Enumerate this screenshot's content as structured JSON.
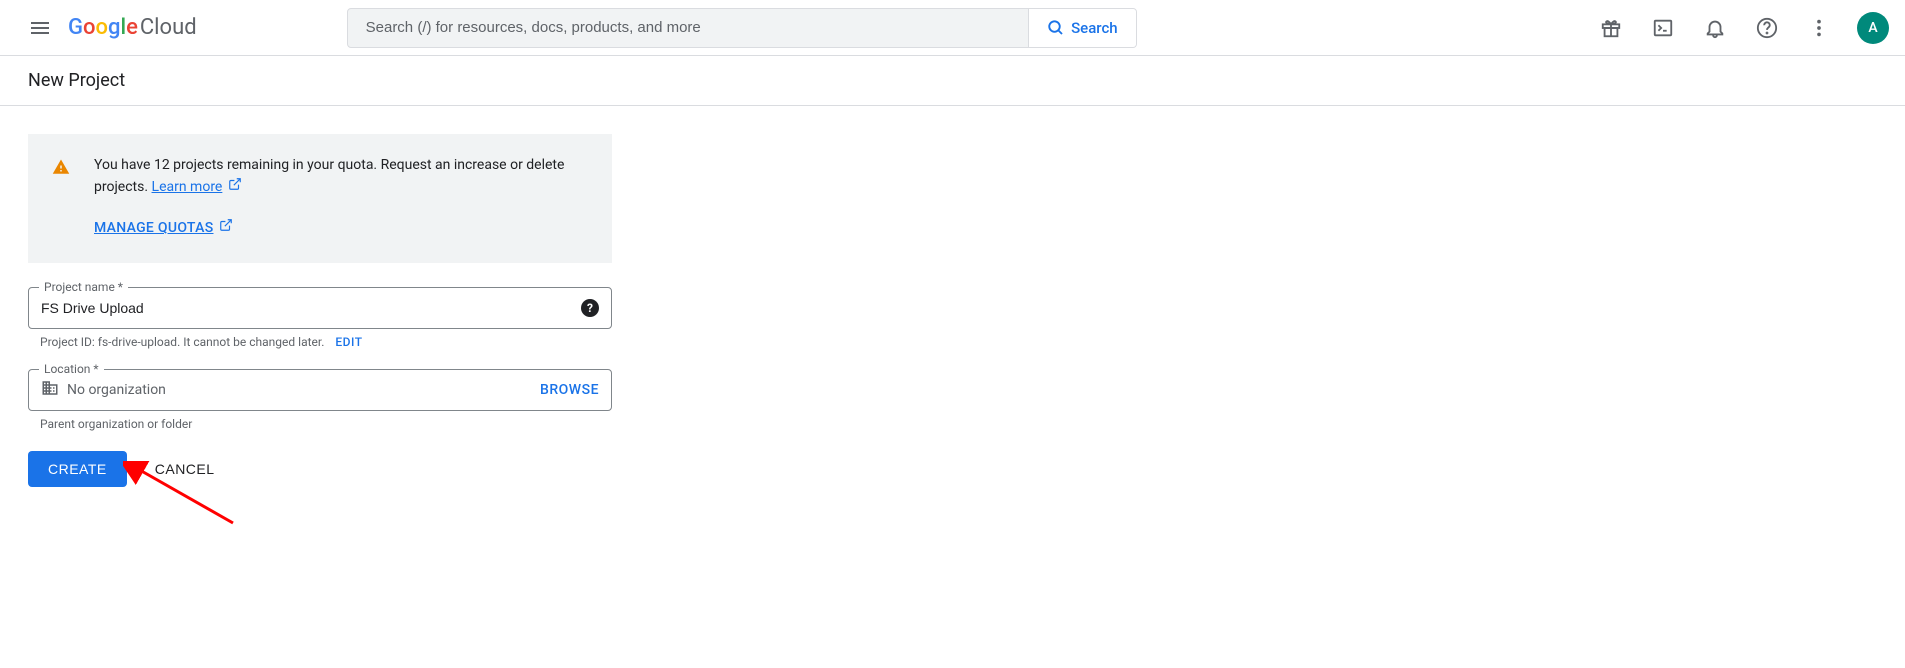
{
  "header": {
    "logo_cloud": "Cloud",
    "search_placeholder": "Search (/) for resources, docs, products, and more",
    "search_button": "Search",
    "avatar_initial": "A"
  },
  "page": {
    "title": "New Project"
  },
  "notice": {
    "text_prefix": "You have 12 projects remaining in your quota. Request an increase or delete projects. ",
    "learn_more": "Learn more",
    "manage_quotas": "MANAGE QUOTAS"
  },
  "form": {
    "project_name_label": "Project name *",
    "project_name_value": "FS Drive Upload",
    "project_id_prefix": "Project ID: fs-drive-upload. It cannot be changed later.",
    "edit_label": "EDIT",
    "location_label": "Location *",
    "location_value": "No organization",
    "browse_label": "BROWSE",
    "location_helper": "Parent organization or folder"
  },
  "buttons": {
    "create": "CREATE",
    "cancel": "CANCEL"
  }
}
